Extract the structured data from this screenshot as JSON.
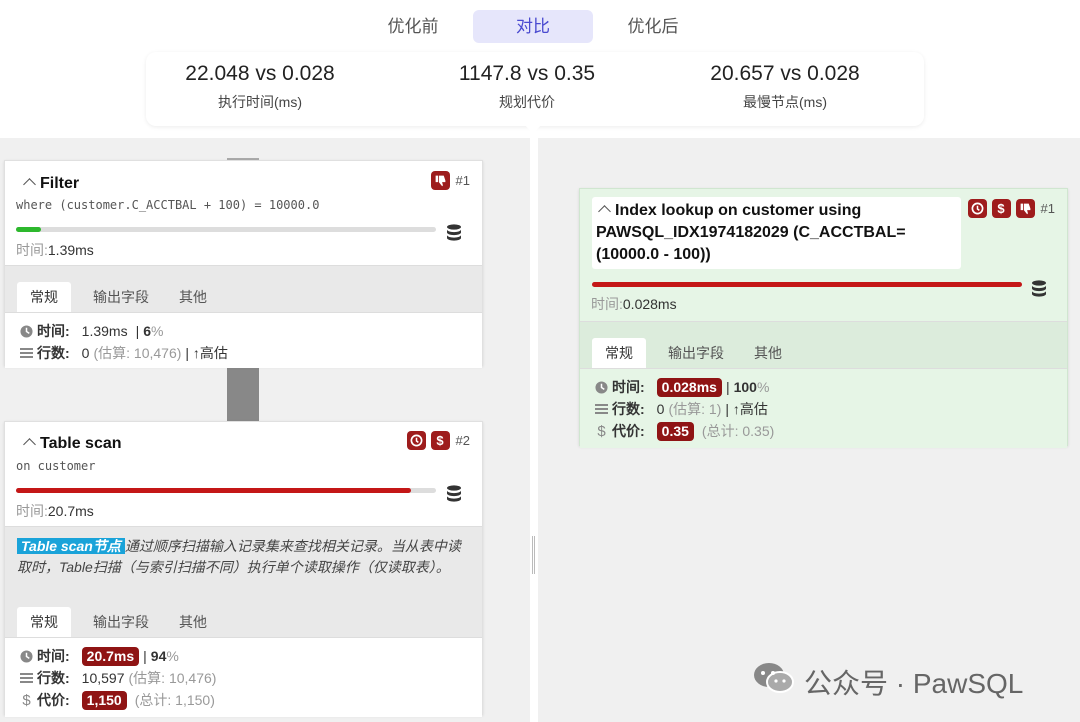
{
  "tabs": [
    "优化前",
    "对比",
    "优化后"
  ],
  "summary": [
    {
      "value": "22.048 vs 0.028",
      "label": "执行时间(ms)"
    },
    {
      "value": "1147.8 vs 0.35",
      "label": "规划代价"
    },
    {
      "value": "20.657 vs 0.028",
      "label": "最慢节点(ms)"
    }
  ],
  "filter_node": {
    "title": "Filter",
    "subtitle": "where (customer.C_ACCTBAL + 100) = 10000.0",
    "num": "#1",
    "progress_percent": 6,
    "bar_color": "#2db82d",
    "time_key": "时间:",
    "time_val": "1.39ms",
    "tabs": [
      "常规",
      "输出字段",
      "其他"
    ],
    "stat_time_label": "时间:",
    "stat_time_value": "1.39ms",
    "stat_time_sep": "|",
    "stat_time_pct_strong": "6",
    "stat_time_pct_rest": "%",
    "stat_rows_label": "行数:",
    "stat_rows_value": "0",
    "stat_rows_est": "(估算: 10,476)",
    "stat_rows_extra": "| ↑高估"
  },
  "scan_node": {
    "title": "Table scan",
    "subtitle": "on customer",
    "num": "#2",
    "progress_percent": 94,
    "bar_color": "#c41717",
    "time_key": "时间:",
    "time_val": "20.7ms",
    "desc_tag": "Table scan节点",
    "desc_text": "通过顺序扫描输入记录集来查找相关记录。当从表中读取时，Table扫描（与索引扫描不同）执行单个读取操作（仅读取表）。",
    "tabs": [
      "常规",
      "输出字段",
      "其他"
    ],
    "stat_time_label": "时间:",
    "stat_time_value": "20.7ms",
    "stat_time_sep": "|",
    "stat_time_pct_strong": "94",
    "stat_time_pct_rest": "%",
    "stat_rows_label": "行数:",
    "stat_rows_value": "10,597",
    "stat_rows_est": "(估算: 10,476)",
    "stat_cost_label": "代价:",
    "stat_cost_value": "1,150",
    "stat_cost_total": "(总计: 1,150)"
  },
  "index_node": {
    "title": "Index lookup on customer using PAWSQL_IDX1974182029 (C_ACCTBAL=(10000.0 - 100))",
    "num": "#1",
    "progress_percent": 100,
    "bar_color": "#c41717",
    "time_key": "时间:",
    "time_val": "0.028ms",
    "tabs": [
      "常规",
      "输出字段",
      "其他"
    ],
    "stat_time_label": "时间:",
    "stat_time_value": "0.028ms",
    "stat_time_sep": "|",
    "stat_time_pct_strong": "100",
    "stat_time_pct_rest": "%",
    "stat_rows_label": "行数:",
    "stat_rows_value": "0",
    "stat_rows_est": "(估算: 1)",
    "stat_rows_extra": "| ↑高估",
    "stat_cost_label": "代价:",
    "stat_cost_value": "0.35",
    "stat_cost_total": "(总计: 0.35)"
  },
  "watermark": "公众号 · PawSQL",
  "colors": {
    "accent": "#4a4ad0",
    "badge": "#9e1c1c",
    "desc_tag": "#1aa3d9",
    "green_card": "#e6f5e6"
  }
}
